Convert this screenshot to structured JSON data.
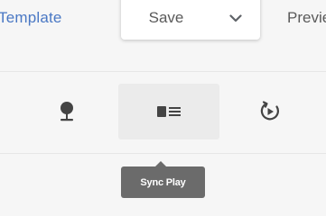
{
  "toolbar": {
    "template_label": "Template",
    "save_label": "Save",
    "preview_label": "Preview"
  },
  "icons": {
    "left": "map-pin-icon",
    "middle": "list-view-icon",
    "right": "sync-play-icon"
  },
  "tooltip": {
    "text": "Sync Play"
  },
  "colors": {
    "link": "#4a78c4",
    "tooltip_bg": "#6b6b6b",
    "active_bg": "#ebebeb",
    "icon": "#444444"
  }
}
